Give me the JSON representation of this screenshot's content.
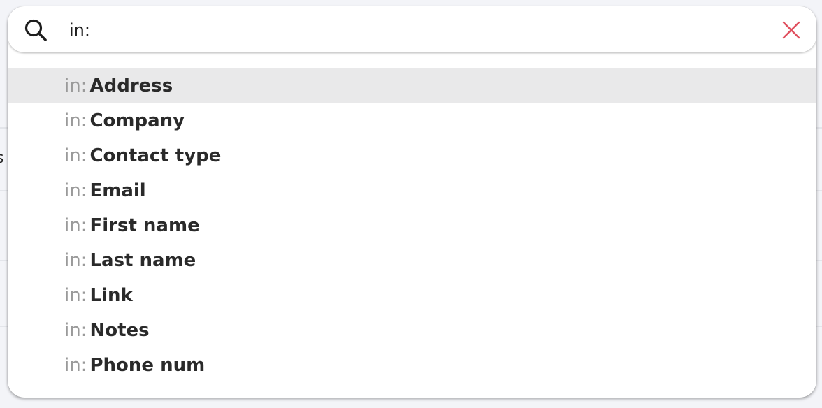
{
  "background": {
    "peek_text": "s"
  },
  "search": {
    "icon": "search-icon",
    "value": "in:",
    "clear_icon": "close-icon",
    "clear_color": "#e0505f"
  },
  "suggestions": {
    "active_index": 0,
    "items": [
      {
        "prefix": "in:",
        "label": "Address"
      },
      {
        "prefix": "in:",
        "label": "Company"
      },
      {
        "prefix": "in:",
        "label": "Contact type"
      },
      {
        "prefix": "in:",
        "label": "Email"
      },
      {
        "prefix": "in:",
        "label": "First name"
      },
      {
        "prefix": "in:",
        "label": "Last name"
      },
      {
        "prefix": "in:",
        "label": "Link"
      },
      {
        "prefix": "in:",
        "label": "Notes"
      },
      {
        "prefix": "in:",
        "label": "Phone num"
      }
    ]
  }
}
